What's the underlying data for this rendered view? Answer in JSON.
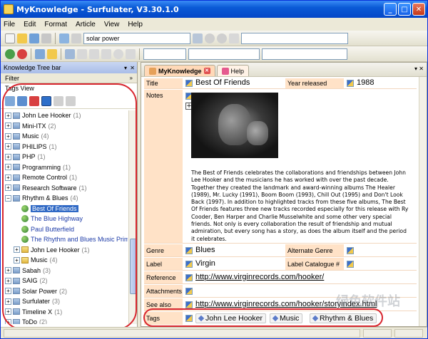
{
  "window": {
    "title": "MyKnowledge - Surfulater, V3.30.1.0"
  },
  "menu": [
    "File",
    "Edit",
    "Format",
    "Article",
    "View",
    "Help"
  ],
  "toolbar": {
    "search_value": "solar power"
  },
  "left_panel": {
    "title": "Knowledge Tree bar",
    "filter_label": "Filter",
    "view_label": "Tags View",
    "tree": [
      {
        "label": "John Lee Hooker",
        "count": "(1)",
        "level": 0,
        "expanded": false
      },
      {
        "label": "Mini-ITX",
        "count": "(2)",
        "level": 0,
        "expanded": false
      },
      {
        "label": "Music",
        "count": "(4)",
        "level": 0,
        "expanded": false
      },
      {
        "label": "PHILIPS",
        "count": "(1)",
        "level": 0,
        "expanded": false
      },
      {
        "label": "PHP",
        "count": "(1)",
        "level": 0,
        "expanded": false
      },
      {
        "label": "Programming",
        "count": "(1)",
        "level": 0,
        "expanded": false
      },
      {
        "label": "Remote Control",
        "count": "(1)",
        "level": 0,
        "expanded": false
      },
      {
        "label": "Research Software",
        "count": "(1)",
        "level": 0,
        "expanded": false
      },
      {
        "label": "Rhythm & Blues",
        "count": "(4)",
        "level": 0,
        "expanded": true
      },
      {
        "label": "Best Of Friends",
        "count": "",
        "level": 1,
        "leaf": true,
        "selected": true
      },
      {
        "label": "The Blue Highway",
        "count": "",
        "level": 1,
        "leaf": true
      },
      {
        "label": "Paul Butterfield",
        "count": "",
        "level": 1,
        "leaf": true
      },
      {
        "label": "The Rhythm and Blues Music Prim",
        "count": "",
        "level": 1,
        "leaf": true
      },
      {
        "label": "John Lee Hooker",
        "count": "(1)",
        "level": 1,
        "expanded": false
      },
      {
        "label": "Music",
        "count": "(4)",
        "level": 1,
        "expanded": false
      },
      {
        "label": "Sabah",
        "count": "(3)",
        "level": 0,
        "expanded": false
      },
      {
        "label": "SAIG",
        "count": "(2)",
        "level": 0,
        "expanded": false
      },
      {
        "label": "Solar Power",
        "count": "(2)",
        "level": 0,
        "expanded": false
      },
      {
        "label": "Surfulater",
        "count": "(3)",
        "level": 0,
        "expanded": false
      },
      {
        "label": "Timeline X",
        "count": "(1)",
        "level": 0,
        "expanded": false
      },
      {
        "label": "ToDo",
        "count": "(2)",
        "level": 0,
        "expanded": false
      }
    ]
  },
  "tabs": [
    {
      "label": "MyKnowledge",
      "active": true
    },
    {
      "label": "Help",
      "active": false
    }
  ],
  "article": {
    "title_label": "Title",
    "title_value": "Best Of Friends",
    "year_label": "Year released",
    "year_value": "1988",
    "notes_label": "Notes",
    "notes_text": "The Best of Friends celebrates the collaborations and friendships between John Lee Hooker and the musicians he has worked with over the past decade. Together they created the landmark and award-winning albums The Healer (1989), Mr. Lucky (1991), Boom Boom (1993), Chill Out (1995) and Don't Look Back (1997). In addition to highlighted tracks from these five albums, The Best Of Friends features three new tracks recorded especially for this release with Ry Cooder, Ben Harper and Charlie Musselwhite and some other very special friends. Not only is every collaboration the result of friendship and mutual admiration, but every song has a story, as does the album itself and the period it celebrates.",
    "genre_label": "Genre",
    "genre_value": "Blues",
    "alt_genre_label": "Alternate Genre",
    "label_label": "Label",
    "label_value": "Virgin",
    "catalogue_label": "Label Catalogue #",
    "reference_label": "Reference",
    "reference_value": "http://www.virginrecords.com/hooker/",
    "attachments_label": "Attachments",
    "see_also_label": "See also",
    "see_also_value": "http://www.virginrecords.com/hooker/storyindex.html",
    "tags_label": "Tags",
    "tags": [
      "John Lee Hooker",
      "Music",
      "Rhythm & Blues"
    ]
  },
  "watermark": "绿色软件站",
  "colors": {
    "accent": "#316AC5",
    "highlight_oval": "#D8262E",
    "field_label_bg": "#FFE2C7"
  }
}
